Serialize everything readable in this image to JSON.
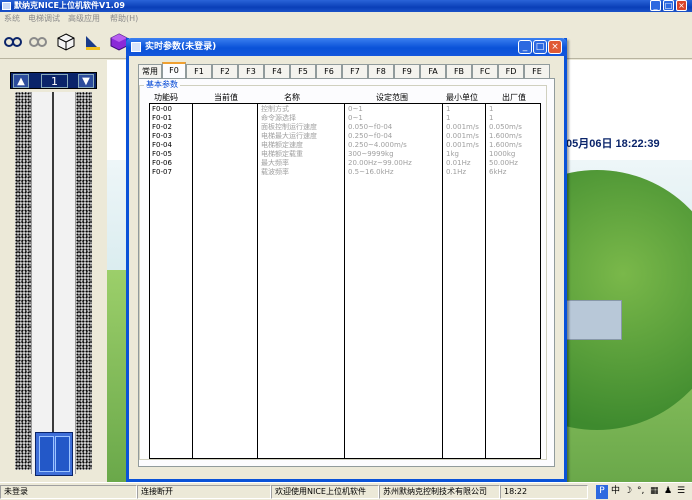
{
  "window": {
    "title": "默纳克NICE上位机软件V1.09",
    "controls": {
      "minimize": "_",
      "maximize": "□",
      "close": "×"
    }
  },
  "menu": {
    "items": [
      "系统",
      "电梯调试",
      "高级应用",
      "帮助(H)"
    ]
  },
  "toolbar": {
    "icons": [
      "chain-link-icon",
      "disconnect-icon",
      "package-icon",
      "chart-icon",
      "cube-icon",
      "document-icon",
      "monitor-icon",
      "tools-icon",
      "crane-icon"
    ]
  },
  "elevator": {
    "floor": "1",
    "up_symbol": "▲",
    "down_symbol": "▼"
  },
  "datetime": "05月06日 18:22:39",
  "dialog": {
    "title": "实时参数(未登录)",
    "tabs": [
      "常用",
      "F0",
      "F1",
      "F2",
      "F3",
      "F4",
      "F5",
      "F6",
      "F7",
      "F8",
      "F9",
      "FA",
      "FB",
      "FC",
      "FD",
      "FE"
    ],
    "active_tab": "F0",
    "group_label": "基本参数",
    "columns": [
      "功能码",
      "当前值",
      "名称",
      "设定范围",
      "最小单位",
      "出厂值"
    ],
    "rows": [
      {
        "code": "F0-00",
        "value": "",
        "name": "控制方式",
        "range": "0~1",
        "unit": "1",
        "default": "1"
      },
      {
        "code": "F0-01",
        "value": "",
        "name": "命令源选择",
        "range": "0~1",
        "unit": "1",
        "default": "1"
      },
      {
        "code": "F0-02",
        "value": "",
        "name": "面板控制运行速度",
        "range": "0.050~f0-04",
        "unit": "0.001m/s",
        "default": "0.050m/s"
      },
      {
        "code": "F0-03",
        "value": "",
        "name": "电梯最大运行速度",
        "range": "0.250~f0-04",
        "unit": "0.001m/s",
        "default": "1.600m/s"
      },
      {
        "code": "F0-04",
        "value": "",
        "name": "电梯额定速度",
        "range": "0.250~4.000m/s",
        "unit": "0.001m/s",
        "default": "1.600m/s"
      },
      {
        "code": "F0-05",
        "value": "",
        "name": "电梯额定载重",
        "range": "300~9999kg",
        "unit": "1kg",
        "default": "1000kg"
      },
      {
        "code": "F0-06",
        "value": "",
        "name": "最大频率",
        "range": "20.00Hz~99.00Hz",
        "unit": "0.01Hz",
        "default": "50.00Hz"
      },
      {
        "code": "F0-07",
        "value": "",
        "name": "载波频率",
        "range": "0.5~16.0kHz",
        "unit": "0.1Hz",
        "default": "6kHz"
      }
    ]
  },
  "statusbar": {
    "login": "未登录",
    "connection": "连接断开",
    "welcome": "欢迎使用NICE上位机软件",
    "company": "苏州默纳克控制技术有限公司",
    "time": "18:22"
  },
  "taskbar_ime": {
    "items": [
      "中",
      "☽",
      "°,",
      "▦",
      "♟",
      "☰"
    ]
  },
  "colors": {
    "title_blue": "#0a52d8",
    "panel": "#ece9d8",
    "tab_highlight": "#f0a030"
  }
}
